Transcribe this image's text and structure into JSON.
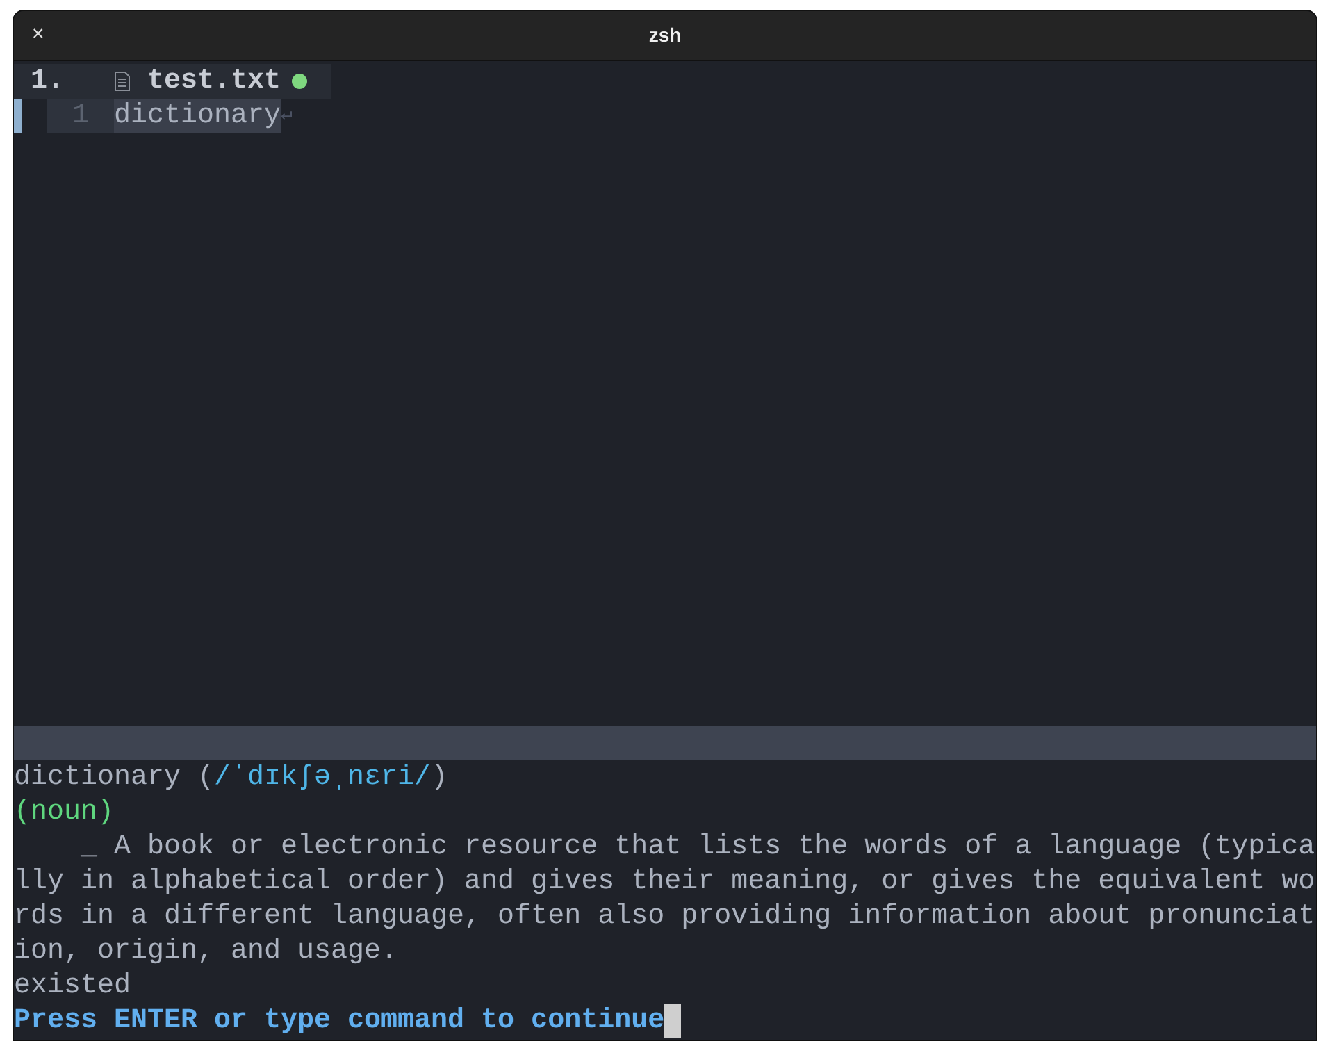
{
  "window": {
    "title": "zsh",
    "close": "×"
  },
  "tabline": {
    "number": "1.",
    "file": "test.txt",
    "modified": true
  },
  "buffer": {
    "lines": [
      {
        "number": "1",
        "text": "dictionary",
        "eol": "↵",
        "current": true
      }
    ]
  },
  "output": [
    {
      "kind": "headword",
      "word": "dictionary (",
      "phonetic": "/ˈdɪkʃəˌnɛri/",
      "close": ")"
    },
    {
      "kind": "pos",
      "text": "(noun)"
    },
    {
      "kind": "plain",
      "text": "    _ A book or electronic resource that lists the words of a language (typica"
    },
    {
      "kind": "plain",
      "text": "lly in alphabetical order) and gives their meaning, or gives the equivalent wo"
    },
    {
      "kind": "plain",
      "text": "rds in a different language, often also providing information about pronunciat"
    },
    {
      "kind": "plain",
      "text": "ion, origin, and usage."
    },
    {
      "kind": "plain",
      "text": "existed"
    },
    {
      "kind": "prompt",
      "text": "Press ENTER or type command to continue"
    }
  ]
}
